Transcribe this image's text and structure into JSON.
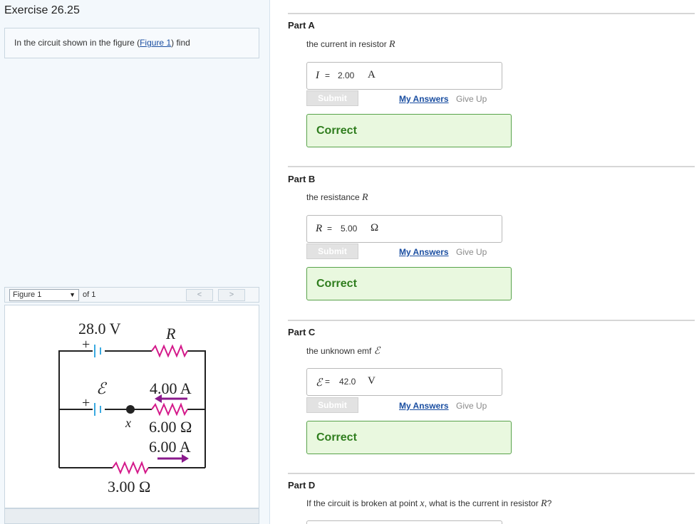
{
  "exercise": {
    "title": "Exercise 26.25"
  },
  "problem": {
    "prefix": "In the circuit shown in the figure (",
    "figure_link": "Figure 1",
    "suffix": ") find"
  },
  "figure_nav": {
    "selected": "Figure 1",
    "of": "of 1",
    "prev": "<",
    "next": ">"
  },
  "circuit": {
    "battery_top": "28.0 V",
    "battery_top_plus": "+",
    "emf_symbol": "ℰ",
    "battery_mid_plus": "+",
    "resistor_r": "R",
    "current_top": "4.00 A",
    "point_label": "x",
    "resistor_mid": "6.00 Ω",
    "current_mid": "6.00 A",
    "resistor_bottom": "3.00 Ω"
  },
  "colors": {
    "wire": "#222222",
    "battery": "#3aa9e0",
    "resistor": "#d4198a",
    "arrow": "#8a1a8c",
    "correct_border": "#58a24a",
    "correct_bg": "#e9f8df",
    "link": "#1a4ea1"
  },
  "parts": [
    {
      "title": "Part A",
      "prompt_prefix": "the current in resistor ",
      "prompt_var": "R",
      "prompt_suffix": "",
      "answer_symbol": "I",
      "answer_eq": "=",
      "answer_value": "2.00",
      "answer_unit": "A",
      "submit": "Submit",
      "my_answers": "My Answers",
      "give_up": "Give Up",
      "status": "Correct"
    },
    {
      "title": "Part B",
      "prompt_prefix": "the resistance ",
      "prompt_var": "R",
      "prompt_suffix": "",
      "answer_symbol": "R",
      "answer_eq": "=",
      "answer_value": "5.00",
      "answer_unit": "Ω",
      "submit": "Submit",
      "my_answers": "My Answers",
      "give_up": "Give Up",
      "status": "Correct"
    },
    {
      "title": "Part C",
      "prompt_prefix": "the unknown emf ",
      "prompt_var": "ℰ",
      "prompt_suffix": "",
      "answer_symbol": "ℰ",
      "answer_eq": "=",
      "answer_value": "42.0",
      "answer_unit": "V",
      "submit": "Submit",
      "my_answers": "My Answers",
      "give_up": "Give Up",
      "status": "Correct"
    },
    {
      "title": "Part D",
      "prompt_prefix": "If the circuit is broken at point ",
      "prompt_var": "x",
      "prompt_mid": ", what is the current in resistor ",
      "prompt_var2": "R",
      "prompt_suffix": "?"
    }
  ]
}
